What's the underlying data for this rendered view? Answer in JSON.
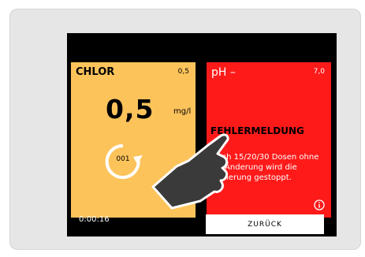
{
  "tiles": {
    "chlor": {
      "title": "CHLOR",
      "setpoint": "0,5",
      "value": "0,5",
      "unit": "mg/l",
      "cycle_count": "001"
    },
    "ph": {
      "title": "pH –",
      "setpoint": "7,0",
      "error_title": "FEHLERMELDUNG",
      "error_text": "Nach 15/20/30 Dosen ohne pH Änderung wird die Dosierung gestoppt."
    }
  },
  "footer": {
    "timer": "0:00:16",
    "back_label": "ZURÜCK"
  },
  "colors": {
    "chlor_tile": "#fdc35b",
    "error_tile": "#ff1a1a",
    "screen": "#000000"
  },
  "icons": [
    "cycle-arrow-icon",
    "info-icon",
    "pointing-hand-icon"
  ]
}
